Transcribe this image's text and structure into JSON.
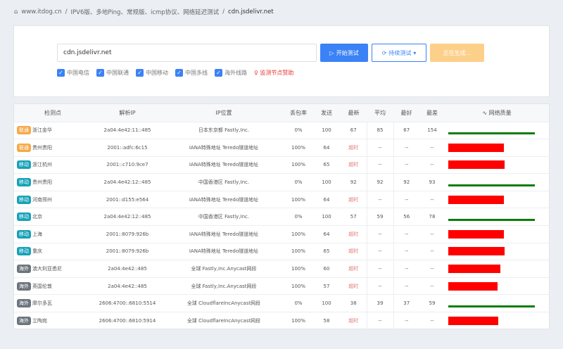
{
  "breadcrumb": {
    "home": "www.itdog.cn",
    "section": "IPV6版、多地Ping、常规版、icmp协议、网络延迟测试",
    "current": "cdn.jsdelivr.net"
  },
  "search": {
    "value": "cdn.jsdelivr.net",
    "start_label": "开始测试",
    "continuous_label": "持续测试",
    "generating_label": "正在生成..."
  },
  "filters": [
    {
      "label": "中国电信",
      "checked": true
    },
    {
      "label": "中国联通",
      "checked": true
    },
    {
      "label": "中国移动",
      "checked": true
    },
    {
      "label": "中国多线",
      "checked": true
    },
    {
      "label": "海外线路",
      "checked": true
    }
  ],
  "sponsor_label": "监测节点赞助",
  "colors": {
    "unicom": "#f5a94a",
    "mobile": "#17a2b8",
    "overseas": "#6c757d",
    "accent": "#3b82f6",
    "timeout": "#ff0000",
    "ok": "#0a7d0a"
  },
  "table": {
    "headers": [
      "检测点",
      "解析IP",
      "IP位置",
      "丢包率",
      "发送",
      "最新",
      "平均",
      "最好",
      "最差",
      "网络质量"
    ],
    "rows": [
      {
        "isp": "联通",
        "type": "unicom",
        "node": "浙江金华",
        "ip": "2a04:4e42:11::485",
        "loc": "日本东京都 Fastly,Inc.",
        "loss": "0%",
        "sent": "100",
        "last": "67",
        "avg": "85",
        "best": "67",
        "worst": "154",
        "quality": "ok"
      },
      {
        "isp": "联通",
        "type": "unicom",
        "node": "贵州贵阳",
        "ip": "2001::adfc:6c15",
        "loc": "IANA特殊地址 Teredo隧道地址",
        "loss": "100%",
        "sent": "64",
        "last": "超时",
        "avg": "--",
        "best": "--",
        "worst": "--",
        "quality": "timeout"
      },
      {
        "isp": "移动",
        "type": "mobile",
        "node": "浙江杭州",
        "ip": "2001::c710:9ce7",
        "loc": "IANA特殊地址 Teredo隧道地址",
        "loss": "100%",
        "sent": "65",
        "last": "超时",
        "avg": "--",
        "best": "--",
        "worst": "--",
        "quality": "timeout"
      },
      {
        "isp": "移动",
        "type": "mobile",
        "node": "贵州贵阳",
        "ip": "2a04:4e42:12::485",
        "loc": "中国香港区 Fastly,Inc.",
        "loss": "0%",
        "sent": "100",
        "last": "92",
        "avg": "92",
        "best": "92",
        "worst": "93",
        "quality": "ok"
      },
      {
        "isp": "移动",
        "type": "mobile",
        "node": "河南郑州",
        "ip": "2001::d155:e564",
        "loc": "IANA特殊地址 Teredo隧道地址",
        "loss": "100%",
        "sent": "64",
        "last": "超时",
        "avg": "--",
        "best": "--",
        "worst": "--",
        "quality": "timeout"
      },
      {
        "isp": "移动",
        "type": "mobile",
        "node": "北京",
        "ip": "2a04:4e42:12::485",
        "loc": "中国香港区 Fastly,Inc.",
        "loss": "0%",
        "sent": "100",
        "last": "57",
        "avg": "59",
        "best": "56",
        "worst": "78",
        "quality": "ok"
      },
      {
        "isp": "移动",
        "type": "mobile",
        "node": "上海",
        "ip": "2001::8079:926b",
        "loc": "IANA特殊地址 Teredo隧道地址",
        "loss": "100%",
        "sent": "64",
        "last": "超时",
        "avg": "--",
        "best": "--",
        "worst": "--",
        "quality": "timeout"
      },
      {
        "isp": "移动",
        "type": "mobile",
        "node": "重庆",
        "ip": "2001::8079:926b",
        "loc": "IANA特殊地址 Teredo隧道地址",
        "loss": "100%",
        "sent": "65",
        "last": "超时",
        "avg": "--",
        "best": "--",
        "worst": "--",
        "quality": "timeout"
      },
      {
        "isp": "海外",
        "type": "overseas",
        "node": "澳大利亚悉尼",
        "ip": "2a04:4e42::485",
        "loc": "全球 Fastly,Inc.Anycast网段",
        "loss": "100%",
        "sent": "60",
        "last": "超时",
        "avg": "--",
        "best": "--",
        "worst": "--",
        "quality": "timeout"
      },
      {
        "isp": "海外",
        "type": "overseas",
        "node": "英国伦敦",
        "ip": "2a04:4e42::485",
        "loc": "全球 Fastly,Inc.Anycast网段",
        "loss": "100%",
        "sent": "57",
        "last": "超时",
        "avg": "--",
        "best": "--",
        "worst": "--",
        "quality": "timeout"
      },
      {
        "isp": "海外",
        "type": "overseas",
        "node": "摩尔多瓦",
        "ip": "2606:4700::6810:5514",
        "loc": "全球 CloudflareIncAnycast网段",
        "loss": "0%",
        "sent": "100",
        "last": "38",
        "avg": "39",
        "best": "37",
        "worst": "59",
        "quality": "ok"
      },
      {
        "isp": "海外",
        "type": "overseas",
        "node": "立陶宛",
        "ip": "2606:4700::6810:5914",
        "loc": "全球 CloudflareIncAnycast网段",
        "loss": "100%",
        "sent": "58",
        "last": "超时",
        "avg": "--",
        "best": "--",
        "worst": "--",
        "quality": "timeout"
      }
    ]
  }
}
